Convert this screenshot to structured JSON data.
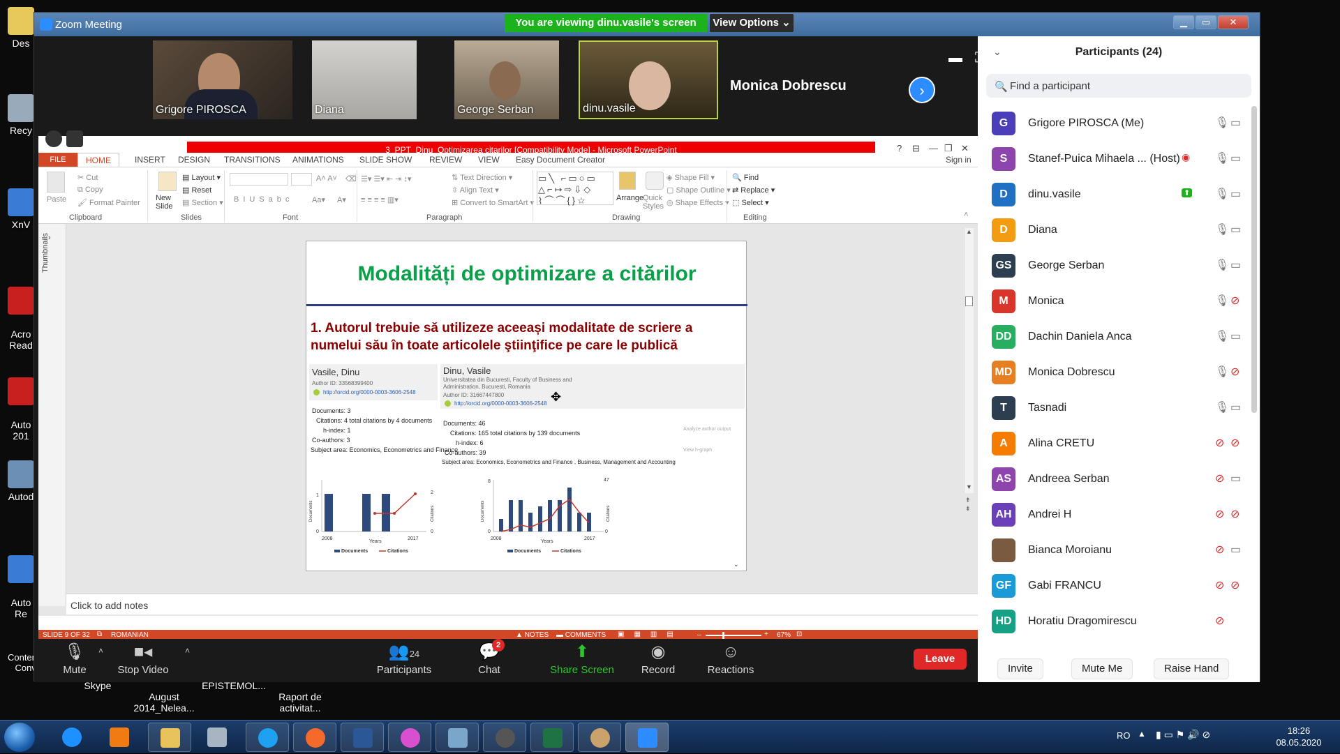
{
  "desktop": {
    "icons": [
      {
        "label": "Des"
      },
      {
        "label": "Recy"
      },
      {
        "label": "XnV"
      },
      {
        "label": "Acro\nRead"
      },
      {
        "label": "Auto\n201"
      },
      {
        "label": "Autod"
      },
      {
        "label": "Auto\nRe"
      },
      {
        "label": "Contenta SID\nConverter"
      },
      {
        "label": "Skype"
      },
      {
        "label": "August\n2014_Nelea..."
      },
      {
        "label": "EPISTEMOL..."
      },
      {
        "label": "Raport de\nactivitat..."
      }
    ]
  },
  "zoom": {
    "window_title": "Zoom Meeting",
    "viewing_banner": "You are viewing dinu.vasile's screen",
    "view_options": "View Options ⌄",
    "tiles": [
      {
        "name": "Grigore PIROSCA"
      },
      {
        "name": "Diana"
      },
      {
        "name": "George Serban"
      },
      {
        "name": "dinu.vasile"
      }
    ],
    "big_name": "Monica Dobrescu",
    "toolbar": {
      "mute": "Mute",
      "stop_video": "Stop Video",
      "participants": "Participants",
      "participants_count": "24",
      "chat": "Chat",
      "chat_badge": "2",
      "share_screen": "Share Screen",
      "record": "Record",
      "reactions": "Reactions",
      "leave": "Leave"
    }
  },
  "ppt": {
    "title": "3_PPT_Dinu_Optimizarea citarilor [Compatibility Mode] - Microsoft PowerPoint",
    "sign_in": "Sign in",
    "tabs": [
      "FILE",
      "HOME",
      "INSERT",
      "DESIGN",
      "TRANSITIONS",
      "ANIMATIONS",
      "SLIDE SHOW",
      "REVIEW",
      "VIEW",
      "Easy Document Creator"
    ],
    "ribbon": {
      "clipboard": "Clipboard",
      "slides": "Slides",
      "font": "Font",
      "paragraph": "Paragraph",
      "drawing": "Drawing",
      "editing": "Editing",
      "paste": "Paste",
      "cut": "Cut",
      "copy": "Copy",
      "format_painter": "Format Painter",
      "new_slide": "New\nSlide",
      "layout": "Layout",
      "reset": "Reset",
      "section": "Section",
      "text_direction": "Text Direction",
      "align_text": "Align Text",
      "convert_smartart": "Convert to SmartArt",
      "arrange": "Arrange",
      "quick_styles": "Quick\nStyles",
      "shape_fill": "Shape Fill",
      "shape_outline": "Shape Outline",
      "shape_effects": "Shape Effects",
      "find": "Find",
      "replace": "Replace",
      "select": "Select"
    },
    "thumbnails_label": "Thumbnails",
    "slide": {
      "title": "Modalități de optimizare a citărilor",
      "point": "1. Autorul trebuie să utilizeze aceeași modalitate de scriere a numelui său în toate articolele ştiinţifice pe care le publică",
      "left_panel": {
        "name": "Vasile, Dinu",
        "author_id": "Author ID: 33568399400",
        "orcid": "http://orcid.org/0000-0003-3606-2548",
        "documents": "Documents: 3",
        "citations": "Citations: 4 total citations by 4 documents",
        "hindex": "h-index: 1",
        "coauthors": "Co-authors: 3",
        "subject": "Subject area: Economics, Econometrics and Finance"
      },
      "right_panel": {
        "name": "Dinu, Vasile",
        "affiliation": "Universitatea din Bucuresti, Faculty of Business and\nAdministration, Bucuresti, Romania",
        "author_id": "Author ID: 31667447800",
        "orcid": "http://orcid.org/0000-0003-3606-2548",
        "documents": "Documents: 46",
        "citations": "Citations: 165 total citations by 139 documents",
        "hindex": "h-index: 6",
        "coauthors": "Co-authors: 39",
        "subject": "Subject area: Economics, Econometrics and Finance , Business, Management and Accounting",
        "analyze": "Analyze author output",
        "view_graph": "View h-graph"
      },
      "chart_left": {
        "ylabel_left": "Documents",
        "ylabel_right": "Citations",
        "xlabel": "Years",
        "x_start": "2008",
        "x_end": "2017",
        "ytick_top": "1",
        "ytick_bottom": "0",
        "y2tick_top": "2",
        "y2tick_bottom": "0"
      },
      "chart_right": {
        "ylabel_left": "Documents",
        "ylabel_right": "Citations",
        "xlabel": "Years",
        "x_start": "2008",
        "x_end": "2017",
        "ytick_top": "8",
        "ytick_bottom": "0",
        "y2tick_top": "47",
        "y2tick_bottom": "0"
      },
      "legend_documents": "Documents",
      "legend_citations": "Citations"
    },
    "notes_placeholder": "Click to add notes",
    "status": {
      "slide": "SLIDE 9 OF 32",
      "language": "ROMANIAN",
      "notes": "NOTES",
      "comments": "COMMENTS",
      "zoom": "67%"
    }
  },
  "participants": {
    "header": "Participants (24)",
    "search_placeholder": "Find a participant",
    "list": [
      {
        "initials": "G",
        "name": "Grigore PIROSCA (Me)",
        "color": "#4a3fb8",
        "mic": "on",
        "cam": "on"
      },
      {
        "initials": "S",
        "name": "Stanef-Puica Mihaela ... (Host)",
        "color": "#8e44ad",
        "mic": "on",
        "cam": "on",
        "recording": true
      },
      {
        "initials": "D",
        "name": "dinu.vasile",
        "color": "#1f6fc2",
        "mic": "on",
        "cam": "on",
        "sharing": true
      },
      {
        "initials": "D",
        "name": "Diana",
        "color": "#f39c12",
        "mic": "on",
        "cam": "on"
      },
      {
        "initials": "GS",
        "name": "George Serban",
        "color": "#2c3e50",
        "mic": "on",
        "cam": "on"
      },
      {
        "initials": "M",
        "name": "Monica",
        "color": "#d9352a",
        "mic": "on",
        "cam": "off"
      },
      {
        "initials": "DD",
        "name": "Dachin Daniela Anca",
        "color": "#27ae60",
        "mic": "on",
        "cam": "on"
      },
      {
        "initials": "MD",
        "name": "Monica Dobrescu",
        "color": "#e67e22",
        "mic": "on",
        "cam": "off"
      },
      {
        "initials": "T",
        "name": "Tasnadi",
        "color": "#2c3e50",
        "mic": "on",
        "cam": "on"
      },
      {
        "initials": "A",
        "name": "Alina CRETU",
        "color": "#f57c00",
        "mic": "off",
        "cam": "off"
      },
      {
        "initials": "AS",
        "name": "Andreea Serban",
        "color": "#8e44ad",
        "mic": "off",
        "cam": "on"
      },
      {
        "initials": "AH",
        "name": "Andrei H",
        "color": "#6a3fb8",
        "mic": "off",
        "cam": "off"
      },
      {
        "initials": "",
        "name": "Bianca Moroianu",
        "color": "#7a5a40",
        "mic": "off",
        "cam": "on"
      },
      {
        "initials": "GF",
        "name": "Gabi FRANCU",
        "color": "#1a9bd7",
        "mic": "off",
        "cam": "off"
      },
      {
        "initials": "HD",
        "name": "Horatiu Dragomirescu",
        "color": "#16a085",
        "mic": "off",
        "cam": "none"
      }
    ],
    "invite": "Invite",
    "mute_me": "Mute Me",
    "raise_hand": "Raise Hand"
  },
  "taskbar": {
    "language": "RO",
    "time": "18:26",
    "date": "08.05.2020"
  }
}
